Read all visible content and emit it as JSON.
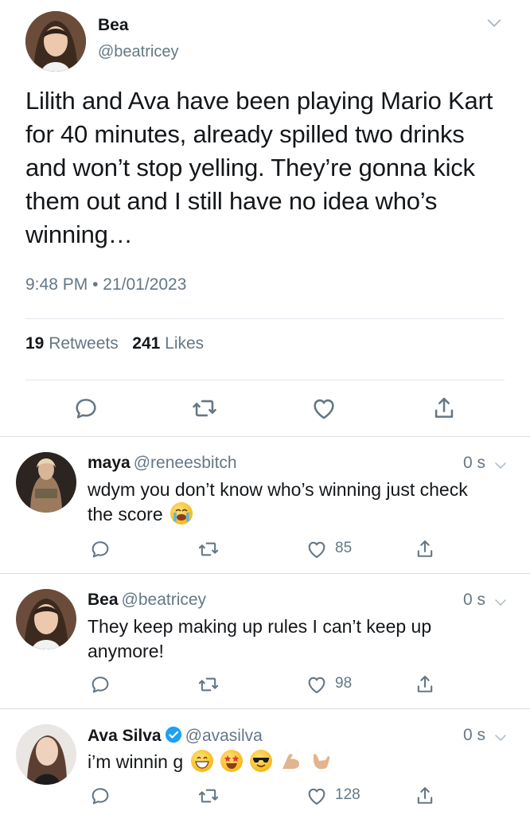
{
  "tweet": {
    "author_name": "Bea",
    "author_handle": "@beatricey",
    "text": "Lilith and Ava have been playing Mario Kart for 40 minutes, already spilled two drinks and won’t stop yelling. They’re gonna kick them out and I still have no idea who’s winning…",
    "time": "9:48 PM",
    "separator": "•",
    "date": "21/01/2023",
    "retweets_count": "19",
    "retweets_label": "Retweets",
    "likes_count": "241",
    "likes_label": "Likes"
  },
  "replies": [
    {
      "name": "maya",
      "handle": "@reneesbitch",
      "verified": false,
      "time": "0 s",
      "text": "wdym you don’t know who’s winning just check the score",
      "emojis": [
        "😭"
      ],
      "likes": "85"
    },
    {
      "name": "Bea",
      "handle": "@beatricey",
      "verified": false,
      "time": "0 s",
      "text": "They keep making up rules I can’t keep up anymore!",
      "emojis": [],
      "likes": "98"
    },
    {
      "name": "Ava Silva",
      "handle": "@avasilva",
      "verified": true,
      "time": "0 s",
      "text": "i’m winnin g",
      "emojis": [
        "😁",
        "🤩",
        "😎",
        "💪🏼",
        "🤙🏼"
      ],
      "likes": "128"
    }
  ],
  "icons": {
    "reply": "reply-icon",
    "retweet": "retweet-icon",
    "like": "heart-icon",
    "share": "share-icon",
    "more": "chevron-down-icon",
    "verified": "verified-badge-icon"
  },
  "colors": {
    "text": "#14171a",
    "secondary": "#657786",
    "divider": "#e1e8ed",
    "verified": "#1da1f2"
  }
}
